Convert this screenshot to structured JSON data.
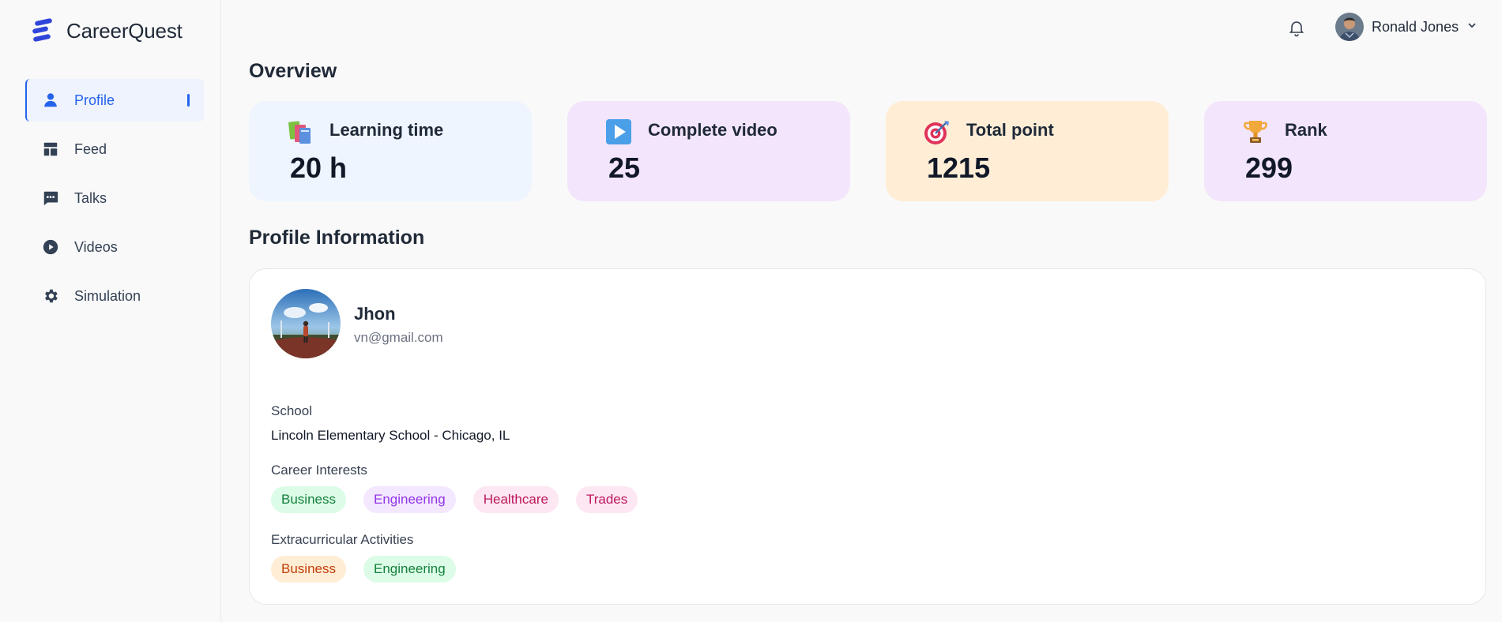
{
  "app": {
    "name": "CareerQuest"
  },
  "sidebar": {
    "items": [
      {
        "label": "Profile",
        "icon": "user-icon",
        "active": true
      },
      {
        "label": "Feed",
        "icon": "layout-icon",
        "active": false
      },
      {
        "label": "Talks",
        "icon": "chat-icon",
        "active": false
      },
      {
        "label": "Videos",
        "icon": "play-circle-icon",
        "active": false
      },
      {
        "label": "Simulation",
        "icon": "gear-icon",
        "active": false
      }
    ]
  },
  "header": {
    "user_name": "Ronald Jones"
  },
  "overview": {
    "title": "Overview",
    "cards": [
      {
        "label": "Learning time",
        "value": "20 h",
        "icon": "books-icon",
        "color": "#eef5fe"
      },
      {
        "label": "Complete video",
        "value": "25",
        "icon": "play-button-icon",
        "color": "#f3e5fc"
      },
      {
        "label": "Total point",
        "value": "1215",
        "icon": "target-icon",
        "color": "#ffedd6"
      },
      {
        "label": "Rank",
        "value": "299",
        "icon": "trophy-icon",
        "color": "#f3e5fc"
      }
    ]
  },
  "profile": {
    "title": "Profile Information",
    "name": "Jhon",
    "email": "vn@gmail.com",
    "school_label": "School",
    "school_value": "Lincoln Elementary School - Chicago, IL",
    "career_label": "Career Interests",
    "career_tags": [
      "Business",
      "Engineering",
      "Healthcare",
      "Trades"
    ],
    "extra_label": "Extracurricular Activities",
    "extra_tags": [
      "Business",
      "Engineering"
    ]
  },
  "colors": {
    "accent": "#2563eb"
  }
}
